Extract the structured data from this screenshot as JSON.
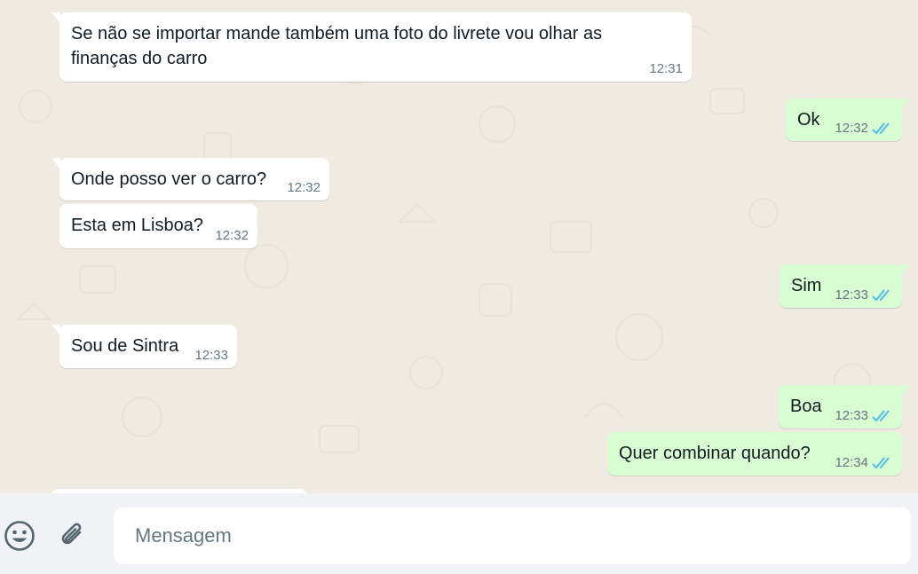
{
  "messages": [
    {
      "dir": "in",
      "text": "Se não se importar mande também uma foto do livrete vou olhar as finanças do carro",
      "time": "12:31"
    },
    {
      "dir": "out",
      "text": "Ok",
      "time": "12:32"
    },
    {
      "dir": "in",
      "text": "Onde posso ver o carro?",
      "time": "12:32"
    },
    {
      "dir": "in",
      "text": "Esta em Lisboa?",
      "time": "12:32"
    },
    {
      "dir": "out",
      "text": "Sim",
      "time": "12:33"
    },
    {
      "dir": "in",
      "text": "Sou de Sintra",
      "time": "12:33"
    },
    {
      "dir": "out",
      "text": "Boa",
      "time": "12:33"
    },
    {
      "dir": "out",
      "text": "Quer combinar quando?",
      "time": "12:34"
    }
  ],
  "composer": {
    "placeholder": "Mensagem",
    "emoji_icon": "emoji-smiley-icon",
    "attach_icon": "paperclip-icon"
  },
  "colors": {
    "background": "#efeae2",
    "incoming": "#ffffff",
    "outgoing": "#d9fdd3",
    "read_ticks": "#53bdeb",
    "meta_text": "#667781"
  }
}
